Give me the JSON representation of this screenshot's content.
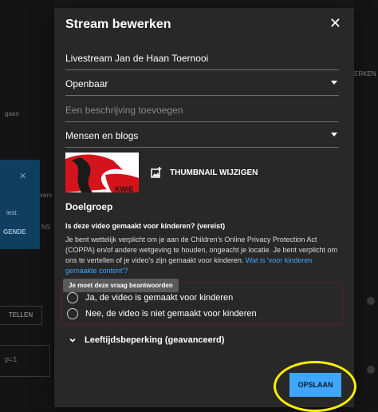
{
  "background": {
    "side_text_1": "gaan",
    "card_text_1": "iest.",
    "card_text_2": "GENDE",
    "ware_text": "vare",
    "ns_text": "NS",
    "tellen_button": "TELLEN",
    "input_value": "p=1",
    "right_tab": "ERKEN"
  },
  "modal": {
    "title": "Stream bewerken",
    "title_field": "Livestream Jan de Haan Toernooi",
    "visibility": "Openbaar",
    "description_placeholder": "Een beschrijving toevoegen",
    "category": "Mensen en blogs",
    "thumbnail_button": "THUMBNAIL WIJZIGEN",
    "audience_heading": "Doelgroep",
    "kids_question": "Is deze video gemaakt voor kinderen? (vereist)",
    "kids_description": "Je bent wettelijk verplicht om je aan de Children's Online Privacy Protection Act (COPPA) en/of andere wetgeving te houden, ongeacht je locatie. Je bent verplicht om ons te vertellen of je video's zijn gemaakt voor kinderen.",
    "kids_link": "Wat is 'voor kinderen gemaakte content'?",
    "error_tooltip": "Je moet deze vraag beantwoorden",
    "option_yes": "Ja, de video is gemaakt voor kinderen",
    "option_no": "Nee, de video is niet gemaakt voor kinderen",
    "age_restriction": "Leeftijdsbeperking (geavanceerd)",
    "save_button": "OPSLAAN"
  },
  "colors": {
    "accent": "#3ea6ff",
    "highlight": "#ffee00",
    "error_border": "#5c1f1f"
  }
}
